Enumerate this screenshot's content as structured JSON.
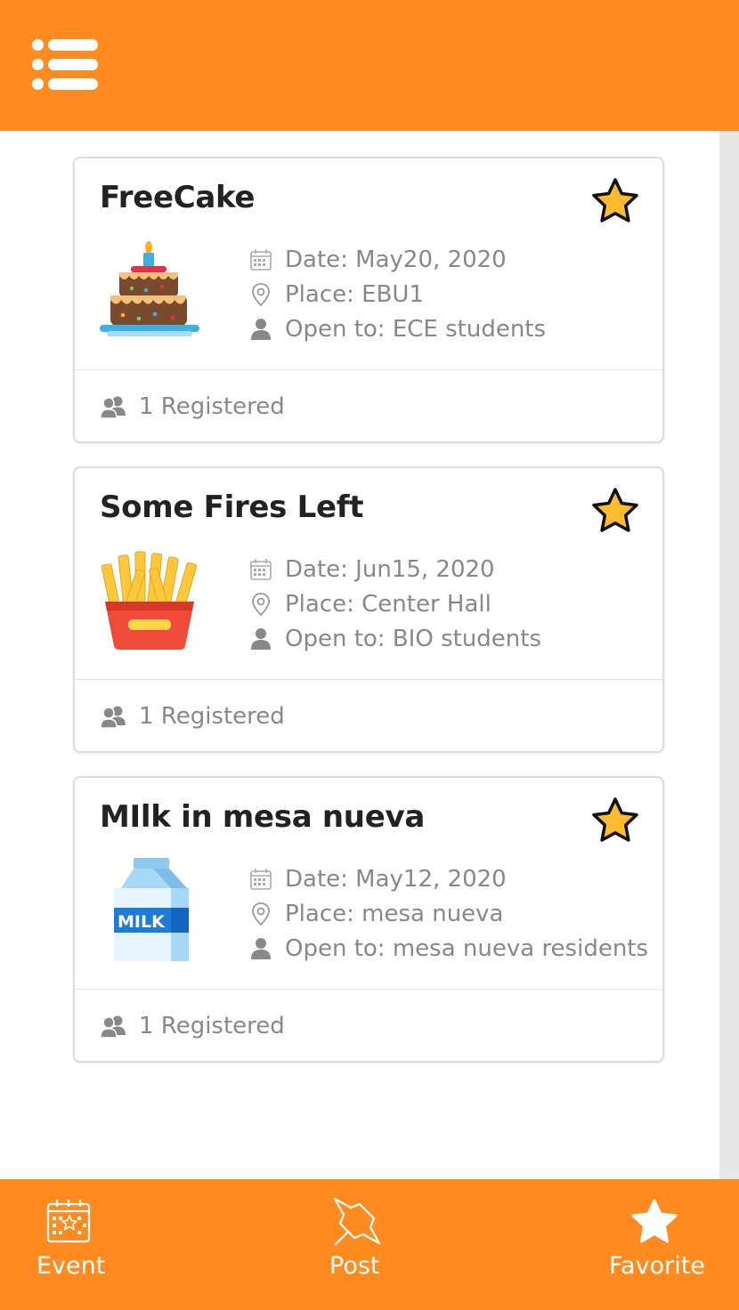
{
  "header": {
    "menu_icon": "hamburger-list-icon"
  },
  "colors": {
    "accent": "#ff8b20",
    "star_fill": "#fdbb2d",
    "muted_text": "#888888"
  },
  "events": [
    {
      "title": "FreeCake",
      "image": "cake-icon",
      "date": "Date: May20, 2020",
      "place": "Place: EBU1",
      "open_to": "Open to: ECE students",
      "registered": "1 Registered"
    },
    {
      "title": "Some Fires Left",
      "image": "french-fries-icon",
      "date": "Date: Jun15, 2020",
      "place": "Place: Center Hall",
      "open_to": "Open to: BIO students",
      "registered": "1 Registered"
    },
    {
      "title": "MIlk in mesa nueva",
      "image": "milk-carton-icon",
      "milk_label": "MILK",
      "date": "Date: May12, 2020",
      "place": "Place: mesa nueva",
      "open_to": "Open to: mesa nueva residents",
      "registered": "1 Registered"
    }
  ],
  "nav": {
    "event_label": "Event",
    "post_label": "Post",
    "favorite_label": "Favorite"
  }
}
